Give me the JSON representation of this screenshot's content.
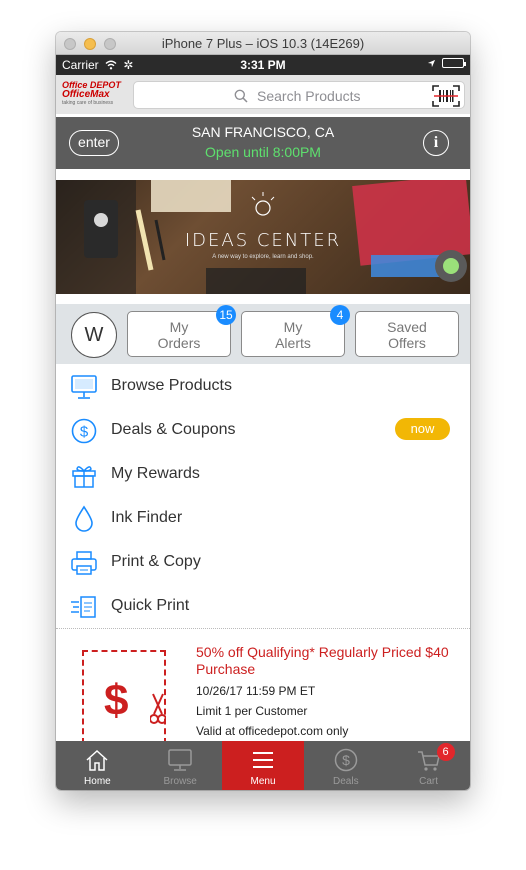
{
  "window": {
    "title": "iPhone 7 Plus – iOS 10.3 (14E269)"
  },
  "status_bar": {
    "carrier": "Carrier",
    "time": "3:31 PM"
  },
  "header": {
    "logo_top": "Office DEPOT",
    "logo_bottom": "OfficeMax",
    "logo_tagline": "taking care of business",
    "search_placeholder": "Search Products"
  },
  "store": {
    "enter_label": "enter",
    "city": "SAN FRANCISCO, CA",
    "hours": "Open until 8:00PM",
    "info_label": "i"
  },
  "banner": {
    "title": "IDEAS CENTER",
    "subtitle": "A new way to explore, learn and shop."
  },
  "account": {
    "avatar_initial": "W",
    "buttons": [
      {
        "line1": "My",
        "line2": "Orders",
        "badge": "15"
      },
      {
        "line1": "My",
        "line2": "Alerts",
        "badge": "4"
      },
      {
        "line1": "Saved",
        "line2": "Offers",
        "badge": ""
      }
    ]
  },
  "menu": {
    "items": [
      {
        "label": "Browse Products",
        "icon": "monitor-icon"
      },
      {
        "label": "Deals & Coupons",
        "icon": "dollar-icon",
        "pill": "now"
      },
      {
        "label": "My Rewards",
        "icon": "gift-icon"
      },
      {
        "label": "Ink Finder",
        "icon": "ink-drop-icon"
      },
      {
        "label": "Print & Copy",
        "icon": "printer-icon"
      },
      {
        "label": "Quick Print",
        "icon": "quick-print-icon"
      }
    ]
  },
  "coupon": {
    "title": "50% off Qualifying* Regularly Priced $40 Purchase",
    "expires": "10/26/17 11:59 PM ET",
    "limit": "Limit 1 per Customer",
    "valid": "Valid at officedepot.com only"
  },
  "tabs": [
    {
      "label": "Home",
      "icon": "home-icon"
    },
    {
      "label": "Browse",
      "icon": "monitor-icon"
    },
    {
      "label": "Menu",
      "icon": "hamburger-icon"
    },
    {
      "label": "Deals",
      "icon": "dollar-icon"
    },
    {
      "label": "Cart",
      "icon": "cart-icon",
      "badge": "6"
    }
  ],
  "colors": {
    "brand_red": "#cc1f1f",
    "accent_blue": "#1a8cff",
    "now_yellow": "#f2b705",
    "hours_green": "#5ee06e"
  }
}
